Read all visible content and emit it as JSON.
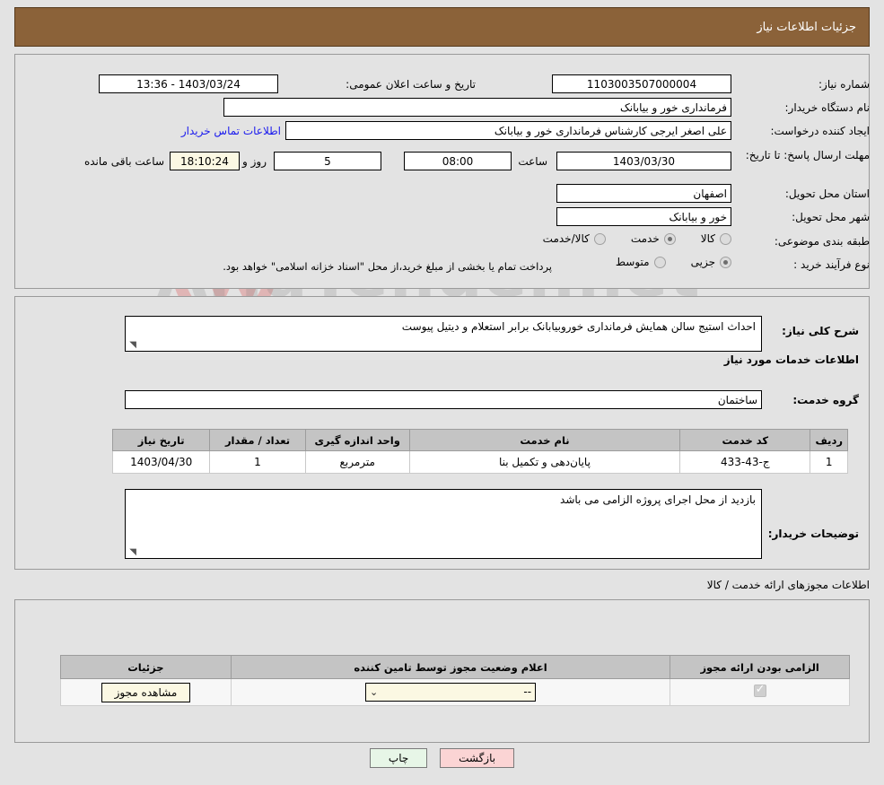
{
  "header": {
    "title": "جزئیات اطلاعات نیاز"
  },
  "watermark": {
    "text": "AriaTender.net",
    "shield_color": "#d9a8a8"
  },
  "top_section": {
    "need_number": {
      "label": "شماره نیاز:",
      "value": "1103003507000004"
    },
    "announce_datetime": {
      "label": "تاریخ و ساعت اعلان عمومی:",
      "value": "1403/03/24 - 13:36"
    },
    "buyer_org": {
      "label": "نام دستگاه خریدار:",
      "value": "فرمانداری خور و بیابانک"
    },
    "request_creator": {
      "label": "ایجاد کننده درخواست:",
      "value": "علی اصغر ایرجی کارشناس فرمانداری خور و بیابانک"
    },
    "contact_link": "اطلاعات تماس خریدار",
    "deadline": {
      "label": "مهلت ارسال پاسخ: تا تاریخ:",
      "date": "1403/03/30",
      "hour_label": "ساعت",
      "hour": "08:00",
      "days": "5",
      "days_label": "روز و",
      "countdown": "18:10:24",
      "countdown_label": "ساعت باقی مانده"
    },
    "province": {
      "label": "استان محل تحویل:",
      "value": "اصفهان"
    },
    "city": {
      "label": "شهر محل تحویل:",
      "value": "خور و بیابانک"
    },
    "category": {
      "label": "طبقه بندی موضوعی:",
      "options": [
        {
          "label": "کالا",
          "selected": false
        },
        {
          "label": "خدمت",
          "selected": true
        },
        {
          "label": "کالا/خدمت",
          "selected": false
        }
      ]
    },
    "process_type": {
      "label": "نوع فرآیند خرید :",
      "options": [
        {
          "label": "جزیی",
          "selected": true
        },
        {
          "label": "متوسط",
          "selected": false
        }
      ],
      "note": "پرداخت تمام یا بخشی از مبلغ خرید،از محل \"اسناد خزانه اسلامی\" خواهد بود."
    }
  },
  "mid_section": {
    "general_desc": {
      "label": "شرح کلی نیاز:",
      "value": "احداث استیج سالن همایش فرمانداری خوروبیابانک برابر استعلام و دیتیل پیوست"
    },
    "services_heading": "اطلاعات خدمات مورد نیاز",
    "service_group": {
      "label": "گروه خدمت:",
      "value": "ساختمان"
    },
    "table": {
      "columns": [
        "ردیف",
        "کد خدمت",
        "نام خدمت",
        "واحد اندازه گیری",
        "تعداد / مقدار",
        "تاریخ نیاز"
      ],
      "rows": [
        {
          "row_no": "1",
          "service_code": "ج-43-433",
          "service_name": "پایان‌دهی و تکمیل بنا",
          "unit": "مترمربع",
          "quantity": "1",
          "need_date": "1403/04/30"
        }
      ]
    },
    "buyer_notes": {
      "label": "توضیحات خریدار:",
      "value": "بازدید از محل اجرای پروژه الزامی می باشد"
    }
  },
  "permits_section": {
    "heading": "اطلاعات مجوزهای ارائه خدمت / کالا",
    "columns": [
      "الزامی بودن ارائه مجوز",
      "اعلام وضعیت مجوز توسط تامین کننده",
      "جزئیات"
    ],
    "rows": [
      {
        "required": true,
        "status_value": "--",
        "details_button": "مشاهده مجوز"
      }
    ]
  },
  "footer": {
    "print_button": "چاپ",
    "back_button": "بازگشت"
  }
}
